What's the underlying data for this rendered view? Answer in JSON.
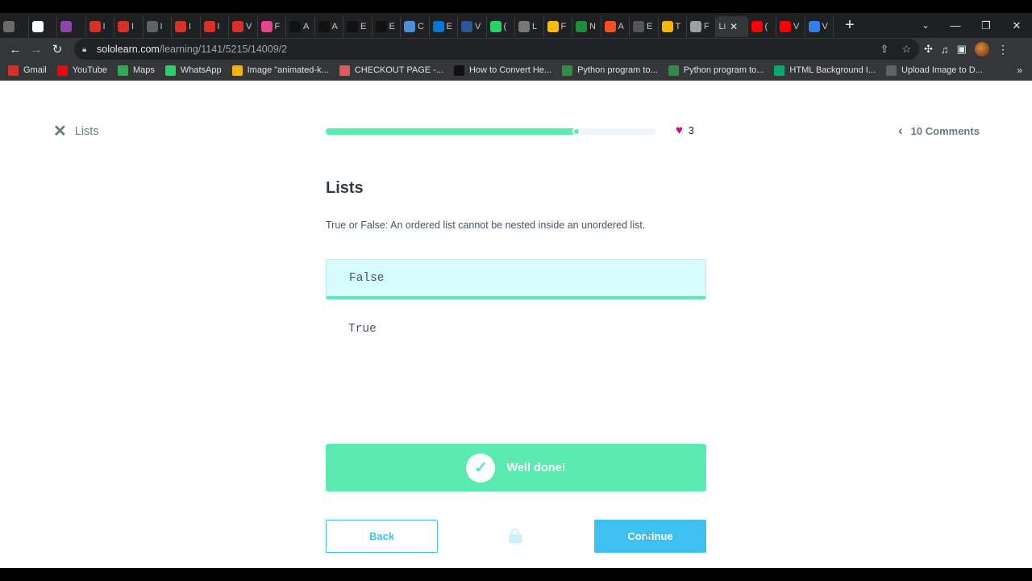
{
  "browser": {
    "tabs": [
      {
        "icon": "gear-icon",
        "label": "",
        "color": "#6b6b6b"
      },
      {
        "icon": "google-icon",
        "label": "",
        "color": "#ffffff"
      },
      {
        "icon": "extension-icon",
        "label": "",
        "color": "#8e44ad"
      },
      {
        "icon": "gmail-icon",
        "label": "I",
        "color": "#d93025"
      },
      {
        "icon": "gmail-icon",
        "label": "I",
        "color": "#d93025"
      },
      {
        "icon": "globe-icon",
        "label": "I",
        "color": "#5f6368"
      },
      {
        "icon": "gmail-icon",
        "label": "I",
        "color": "#d93025"
      },
      {
        "icon": "gmail-icon",
        "label": "I",
        "color": "#d93025"
      },
      {
        "icon": "gmail-icon",
        "label": "V",
        "color": "#d93025"
      },
      {
        "icon": "spiral-icon",
        "label": "F",
        "color": "#e84393"
      },
      {
        "icon": "amazon-icon",
        "label": "A",
        "color": "#111111"
      },
      {
        "icon": "amazon-icon",
        "label": "A",
        "color": "#111111"
      },
      {
        "icon": "amazon-icon",
        "label": "E",
        "color": "#111111"
      },
      {
        "icon": "amazon-icon",
        "label": "E",
        "color": "#111111"
      },
      {
        "icon": "camera-icon",
        "label": "C",
        "color": "#4a90d9"
      },
      {
        "icon": "outlook-icon",
        "label": "E",
        "color": "#0078d4"
      },
      {
        "icon": "word-icon",
        "label": "V",
        "color": "#2b579a"
      },
      {
        "icon": "whatsapp-icon",
        "label": "(",
        "color": "#25d366"
      },
      {
        "icon": "robot-icon",
        "label": "L",
        "color": "#777777"
      },
      {
        "icon": "drive-icon",
        "label": "F",
        "color": "#fbbc04"
      },
      {
        "icon": "classroom-icon",
        "label": "N",
        "color": "#1e8e3e"
      },
      {
        "icon": "microsoft-icon",
        "label": "A",
        "color": "#f25022"
      },
      {
        "icon": "figure-icon",
        "label": "E",
        "color": "#555555"
      },
      {
        "icon": "note-icon",
        "label": "T",
        "color": "#f4b400"
      },
      {
        "icon": "page-icon",
        "label": "F",
        "color": "#9aa0a6"
      }
    ],
    "active_tab": {
      "icon": "sololearn-icon",
      "label": "Li",
      "close": "✕"
    },
    "tabs_after": [
      {
        "icon": "youtube-icon",
        "label": "(",
        "color": "#ff0000"
      },
      {
        "icon": "youtube-icon",
        "label": "V",
        "color": "#ff0000"
      },
      {
        "icon": "edge-icon",
        "label": "V",
        "color": "#2f80ed"
      }
    ],
    "new_tab": "+",
    "url_domain": "sololearn.com",
    "url_path": "/learning/1141/5215/14009/2",
    "bookmarks": [
      {
        "icon": "gmail-icon",
        "label": "Gmail",
        "color": "#d93025"
      },
      {
        "icon": "youtube-icon",
        "label": "YouTube",
        "color": "#ff0000"
      },
      {
        "icon": "maps-icon",
        "label": "Maps",
        "color": "#34a853"
      },
      {
        "icon": "whatsapp-icon",
        "label": "WhatsApp",
        "color": "#25d366"
      },
      {
        "icon": "star-icon",
        "label": "Image \"animated-k...",
        "color": "#f4b400"
      },
      {
        "icon": "checkout-icon",
        "label": "CHECKOUT PAGE -...",
        "color": "#e05a5a"
      },
      {
        "icon": "alpha-icon",
        "label": "How to Convert He...",
        "color": "#111111"
      },
      {
        "icon": "gfg-icon",
        "label": "Python program to...",
        "color": "#2f8d46"
      },
      {
        "icon": "gfg-icon",
        "label": "Python program to...",
        "color": "#2f8d46"
      },
      {
        "icon": "w3-icon",
        "label": "HTML Background I...",
        "color": "#04aa6d"
      },
      {
        "icon": "globe-icon",
        "label": "Upload Image to D...",
        "color": "#5f6368"
      }
    ],
    "bookmarks_more": "»"
  },
  "lesson": {
    "close_label": "Lists",
    "progress": 0.76,
    "hearts": "3",
    "comments_label": "10 Comments",
    "title": "Lists",
    "question": "True or False: An ordered list cannot be nested inside an unordered list.",
    "options": [
      {
        "label": "False",
        "selected": true
      },
      {
        "label": "True",
        "selected": false
      }
    ],
    "feedback": "Well done!",
    "back_label": "Back",
    "continue_label": "Continue"
  },
  "colors": {
    "success": "#5bebb0",
    "primary": "#3ec0f0",
    "heart": "#e4007c",
    "selected_bg": "#d7fcfe"
  }
}
